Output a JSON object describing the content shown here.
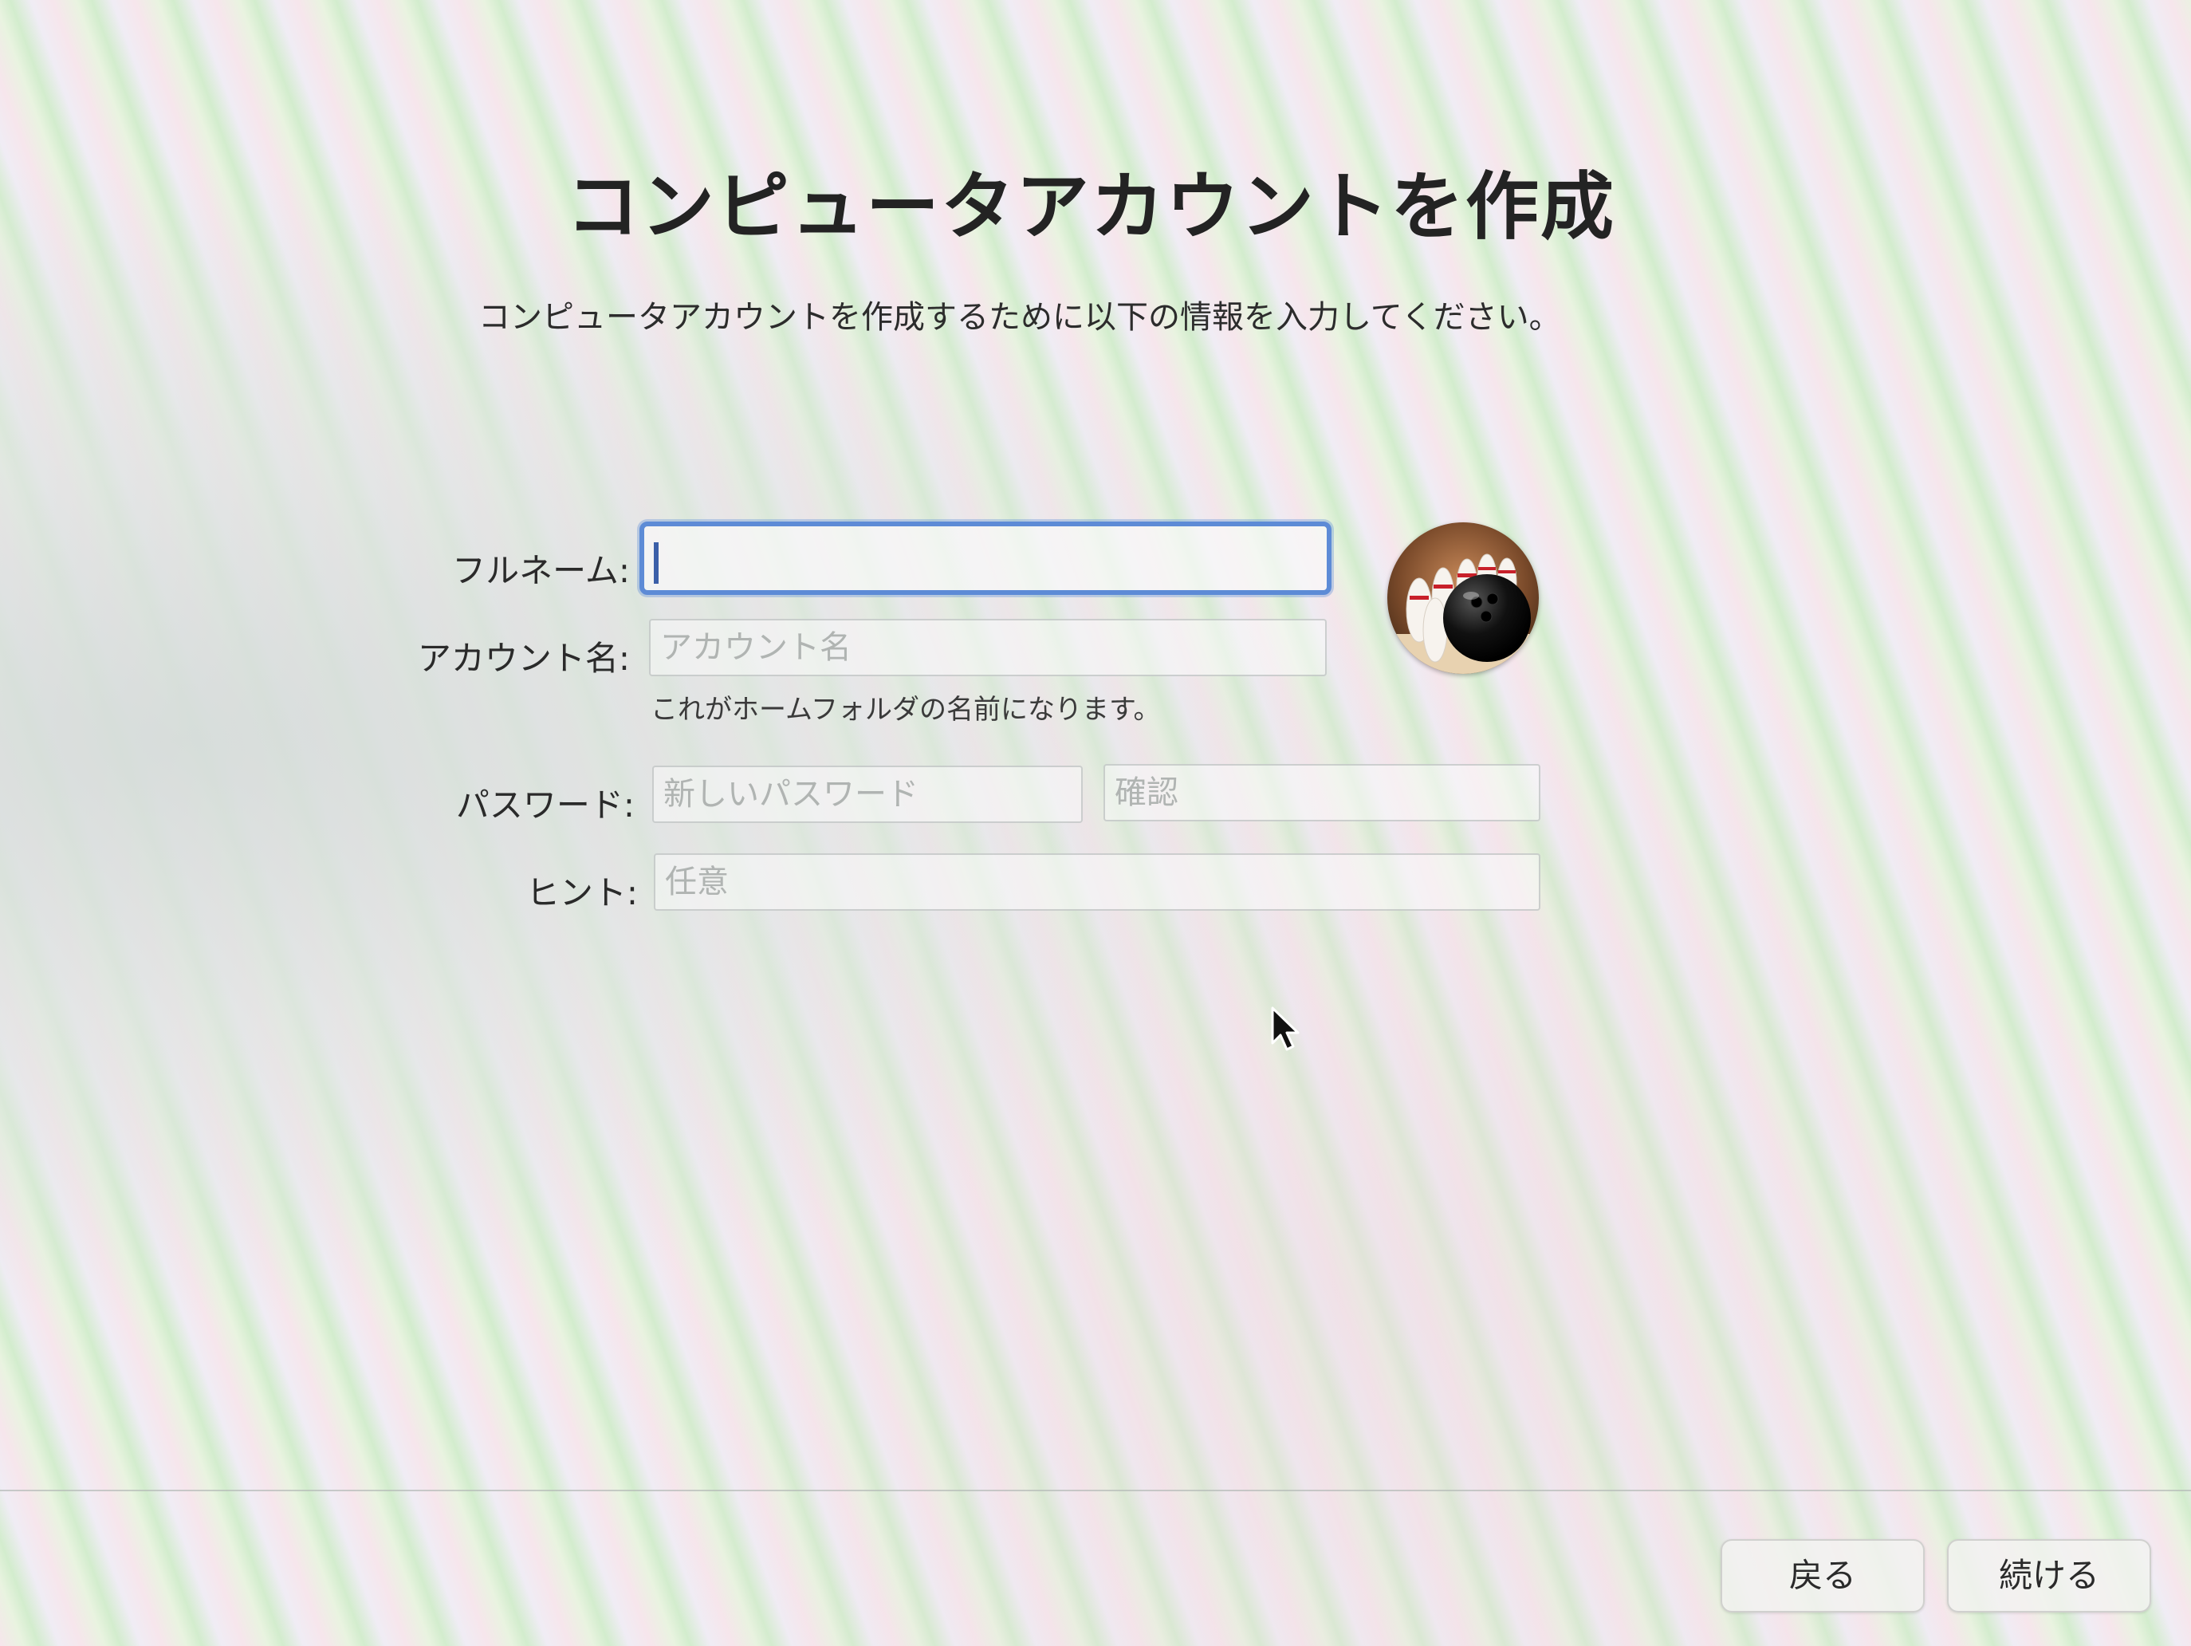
{
  "header": {
    "title": "コンピュータアカウントを作成",
    "subtitle": "コンピュータアカウントを作成するために以下の情報を入力してください。"
  },
  "form": {
    "full_name": {
      "label": "フルネーム:",
      "value": "",
      "placeholder": ""
    },
    "account_name": {
      "label": "アカウント名:",
      "value": "",
      "placeholder": "アカウント名",
      "note": "これがホームフォルダの名前になります。"
    },
    "password": {
      "label": "パスワード:",
      "placeholder": "新しいパスワード",
      "confirm_placeholder": "確認"
    },
    "hint": {
      "label": "ヒント:",
      "placeholder": "任意"
    }
  },
  "avatar": {
    "icon": "bowling-ball-pins-icon"
  },
  "footer": {
    "back_label": "戻る",
    "continue_label": "続ける"
  },
  "colors": {
    "focus_ring": "#5d8bd6",
    "text": "#2a2a2a"
  }
}
